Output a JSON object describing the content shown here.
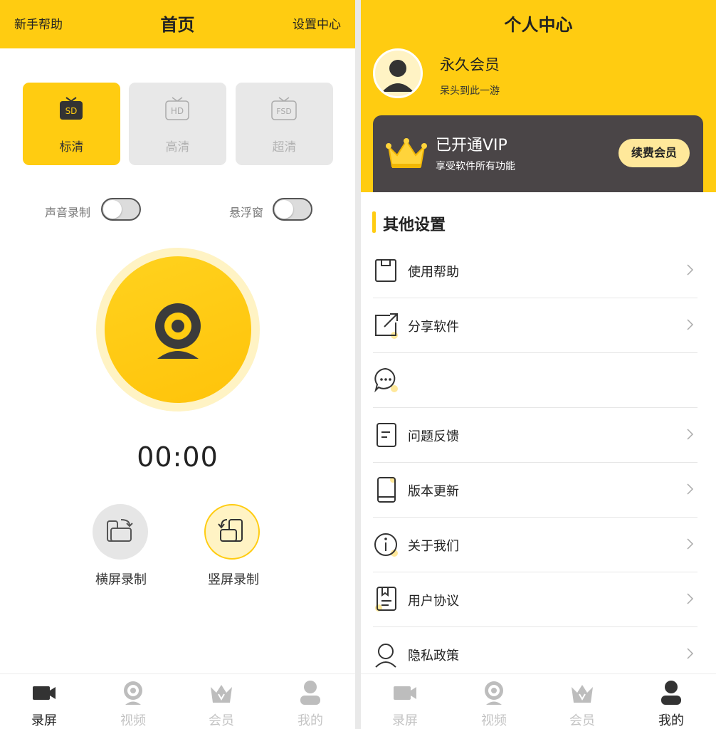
{
  "left": {
    "header": {
      "help": "新手帮助",
      "title": "首页",
      "settings": "设置中心"
    },
    "quality": [
      {
        "badge": "SD",
        "label": "标清",
        "active": true
      },
      {
        "badge": "HD",
        "label": "高清",
        "active": false
      },
      {
        "badge": "FSD",
        "label": "超清",
        "active": false
      }
    ],
    "toggles": {
      "audio_label": "声音录制",
      "audio_on": false,
      "float_label": "悬浮窗",
      "float_on": false
    },
    "timer": "00:00",
    "orientation": {
      "landscape": "横屏录制",
      "portrait": "竖屏录制",
      "selected": "portrait"
    },
    "tabs": [
      {
        "label": "录屏",
        "icon": "video-camera-icon",
        "active": true
      },
      {
        "label": "视频",
        "icon": "webcam-icon",
        "active": false
      },
      {
        "label": "会员",
        "icon": "crown-icon",
        "active": false
      },
      {
        "label": "我的",
        "icon": "user-icon",
        "active": false
      }
    ]
  },
  "right": {
    "header": {
      "title": "个人中心"
    },
    "profile": {
      "name": "永久会员",
      "subtitle": "呆头到此一游"
    },
    "vip": {
      "title": "已开通VIP",
      "subtitle": "享受软件所有功能",
      "renew": "续费会员"
    },
    "section_title": "其他设置",
    "menu": [
      {
        "label": "使用帮助",
        "icon": "help-doc-icon",
        "chevron": true
      },
      {
        "label": "分享软件",
        "icon": "share-icon",
        "chevron": true
      },
      {
        "label": "",
        "icon": "chat-bubble-icon",
        "chevron": false
      },
      {
        "label": "问题反馈",
        "icon": "feedback-icon",
        "chevron": true
      },
      {
        "label": "版本更新",
        "icon": "phone-update-icon",
        "chevron": true
      },
      {
        "label": "关于我们",
        "icon": "info-icon",
        "chevron": true
      },
      {
        "label": "用户协议",
        "icon": "agreement-icon",
        "chevron": true
      },
      {
        "label": "隐私政策",
        "icon": "privacy-icon",
        "chevron": true
      }
    ],
    "tabs": [
      {
        "label": "录屏",
        "icon": "video-camera-icon",
        "active": false
      },
      {
        "label": "视频",
        "icon": "webcam-icon",
        "active": false
      },
      {
        "label": "会员",
        "icon": "crown-icon",
        "active": false
      },
      {
        "label": "我的",
        "icon": "user-icon",
        "active": true
      }
    ]
  },
  "colors": {
    "accent": "#FFCC11",
    "accent_light": "#FFF3C4",
    "vip_card": "#4a4547",
    "text_dark": "#222222",
    "text_muted": "#b3b3b3"
  }
}
